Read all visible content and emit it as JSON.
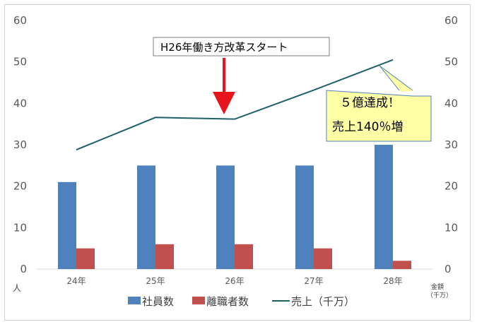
{
  "chart_data": {
    "type": "bar",
    "categories": [
      "24年",
      "25年",
      "26年",
      "27年",
      "28年"
    ],
    "series": [
      {
        "name": "社員数",
        "kind": "bar",
        "axis": "left",
        "color": "#4f81bd",
        "values": [
          21,
          25,
          25,
          25,
          30
        ]
      },
      {
        "name": "離職者数",
        "kind": "bar",
        "axis": "left",
        "color": "#c0504d",
        "values": [
          5,
          6,
          6,
          5,
          2
        ]
      },
      {
        "name": "売上（千万）",
        "kind": "line",
        "axis": "right",
        "color": "#1f5f6b",
        "values": [
          28.8,
          36.6,
          36.2,
          43.2,
          50.5
        ]
      }
    ],
    "ylim": [
      0,
      60
    ],
    "y2lim": [
      0,
      60
    ],
    "yticks": [
      "0",
      "10",
      "20",
      "30",
      "40",
      "50",
      "60"
    ],
    "ylabel": "人",
    "y2label_line1": "金額",
    "y2label_line2": "（千万）",
    "grid": false,
    "legend_position": "bottom",
    "annotations": {
      "reform_label": "H26年働き方改革スタート",
      "callout_line1": "５億達成！",
      "callout_line2": "売上140％増"
    }
  },
  "colors": {
    "annotation_arrow": "#e8141b",
    "callout_fill": "#ffffa6",
    "callout_border": "#4f81bd",
    "axis_line": "#d9d9d9"
  }
}
